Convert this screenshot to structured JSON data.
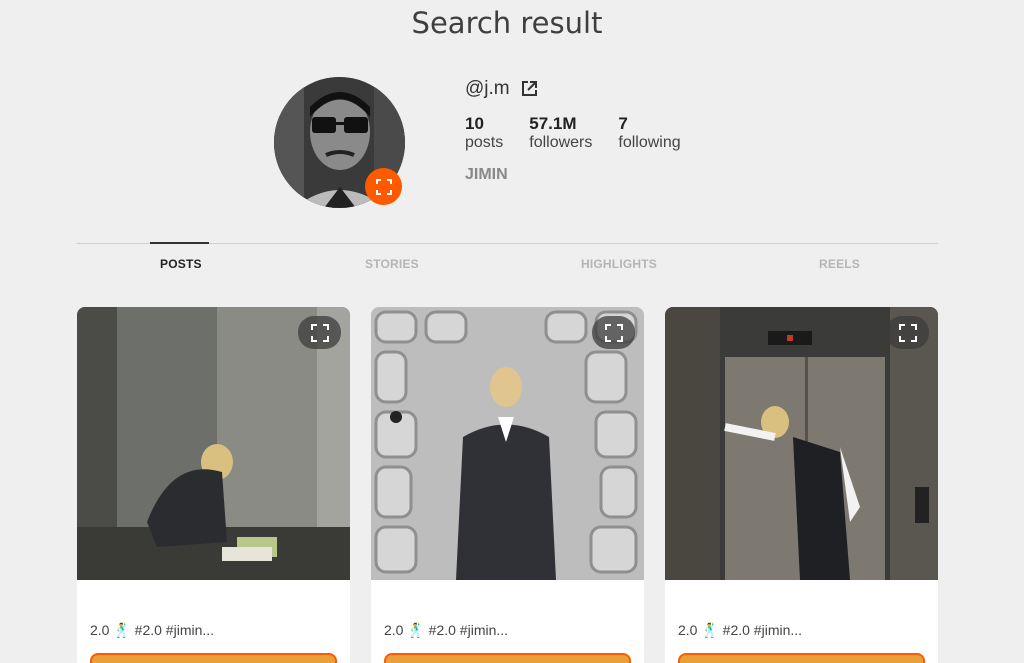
{
  "header": {
    "title": "Search result"
  },
  "profile": {
    "handle": "@j.m",
    "display_name": "JIMIN",
    "stats": [
      {
        "value": "10",
        "label": "posts"
      },
      {
        "value": "57.1M",
        "label": "followers"
      },
      {
        "value": "7",
        "label": "following"
      }
    ]
  },
  "tabs": [
    {
      "label": "POSTS",
      "active": true
    },
    {
      "label": "STORIES",
      "active": false
    },
    {
      "label": "HIGHLIGHTS",
      "active": false
    },
    {
      "label": "REELS",
      "active": false
    }
  ],
  "posts": [
    {
      "caption": "2.0 🕺 #2.0 #jimin..."
    },
    {
      "caption": "2.0 🕺 #2.0 #jimin..."
    },
    {
      "caption": "2.0 🕺 #2.0 #jimin..."
    }
  ],
  "colors": {
    "accent": "#ff5a00",
    "background": "#efefef"
  }
}
